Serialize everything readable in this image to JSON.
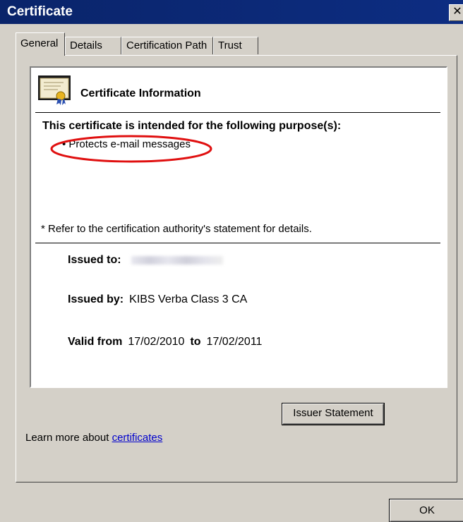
{
  "window": {
    "title": "Certificate",
    "close_label": "✕"
  },
  "tabs": [
    {
      "label": "General"
    },
    {
      "label": "Details"
    },
    {
      "label": "Certification Path"
    },
    {
      "label": "Trust"
    }
  ],
  "info": {
    "title": "Certificate Information",
    "purpose_heading": "This certificate is intended for the following purpose(s):",
    "purposes": [
      "• Protects e-mail messages"
    ],
    "footnote": "* Refer to the certification authority's statement for details.",
    "issued_to_label": "Issued to:",
    "issued_by_label": "Issued by:",
    "issued_by_value": "KIBS Verba Class 3 CA",
    "valid_from_label": "Valid from",
    "valid_from": "17/02/2010",
    "to_label": "to",
    "valid_to": "17/02/2011"
  },
  "buttons": {
    "issuer_statement": "Issuer Statement",
    "ok": "OK"
  },
  "learn_more": {
    "prefix": "Learn more about ",
    "link": "certificates"
  },
  "colors": {
    "titlebar": "#0a246a",
    "highlight": "#e01010",
    "link": "#0000cc"
  },
  "icons": [
    "certificate-icon",
    "close-icon"
  ]
}
